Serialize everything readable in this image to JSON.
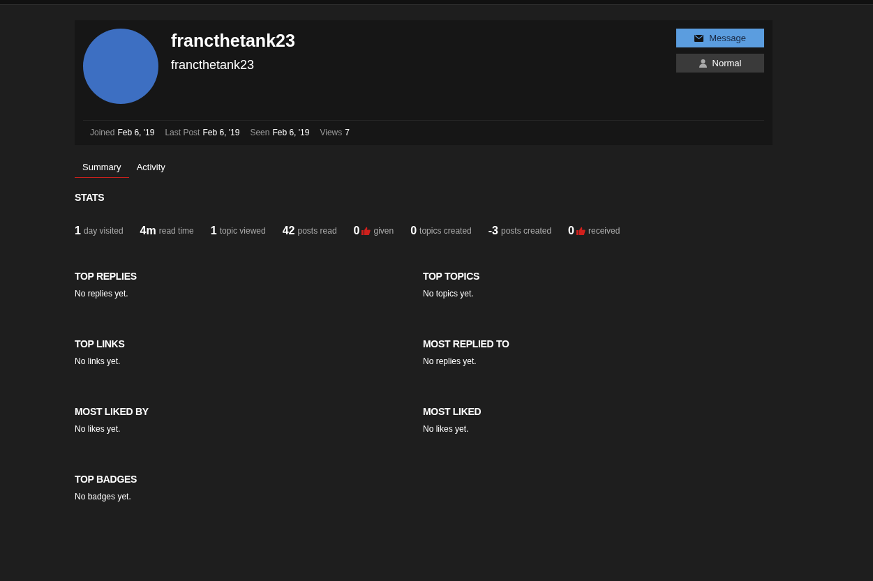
{
  "profile": {
    "username": "francthetank23",
    "name": "francthetank23"
  },
  "buttons": [
    {
      "kind": "message",
      "label": "Message"
    },
    {
      "kind": "user",
      "label": "Normal"
    }
  ],
  "meta": [
    {
      "label": "Joined",
      "value": "Feb 6, '19"
    },
    {
      "label": "Last Post",
      "value": "Feb 6, '19"
    },
    {
      "label": "Seen",
      "value": "Feb 6, '19"
    },
    {
      "label": "Views",
      "value": "7"
    }
  ],
  "tabs": [
    {
      "label": "Summary",
      "selected": true
    },
    {
      "label": "Activity",
      "selected": false
    }
  ],
  "stats_title": "STATS",
  "stats": [
    {
      "kind": "plain",
      "value": "1",
      "label": "day visited"
    },
    {
      "kind": "plain",
      "value": "4m",
      "label": "read time"
    },
    {
      "kind": "plain",
      "value": "1",
      "label": "topic viewed"
    },
    {
      "kind": "plain",
      "value": "42",
      "label": "posts read"
    },
    {
      "kind": "like",
      "value": "0",
      "label": "given"
    },
    {
      "kind": "plain",
      "value": "0",
      "label": "topics created"
    },
    {
      "kind": "plain",
      "value": "-3",
      "label": "posts created"
    },
    {
      "kind": "like",
      "value": "0",
      "label": "received"
    }
  ],
  "sections": [
    {
      "title": "TOP REPLIES",
      "empty": "No replies yet."
    },
    {
      "title": "TOP TOPICS",
      "empty": "No topics yet."
    },
    {
      "title": "TOP LINKS",
      "empty": "No links yet."
    },
    {
      "title": "MOST REPLIED TO",
      "empty": "No replies yet."
    },
    {
      "title": "MOST LIKED BY",
      "empty": "No likes yet."
    },
    {
      "title": "MOST LIKED",
      "empty": "No likes yet."
    },
    {
      "title": "TOP BADGES",
      "empty": "No badges yet."
    }
  ]
}
